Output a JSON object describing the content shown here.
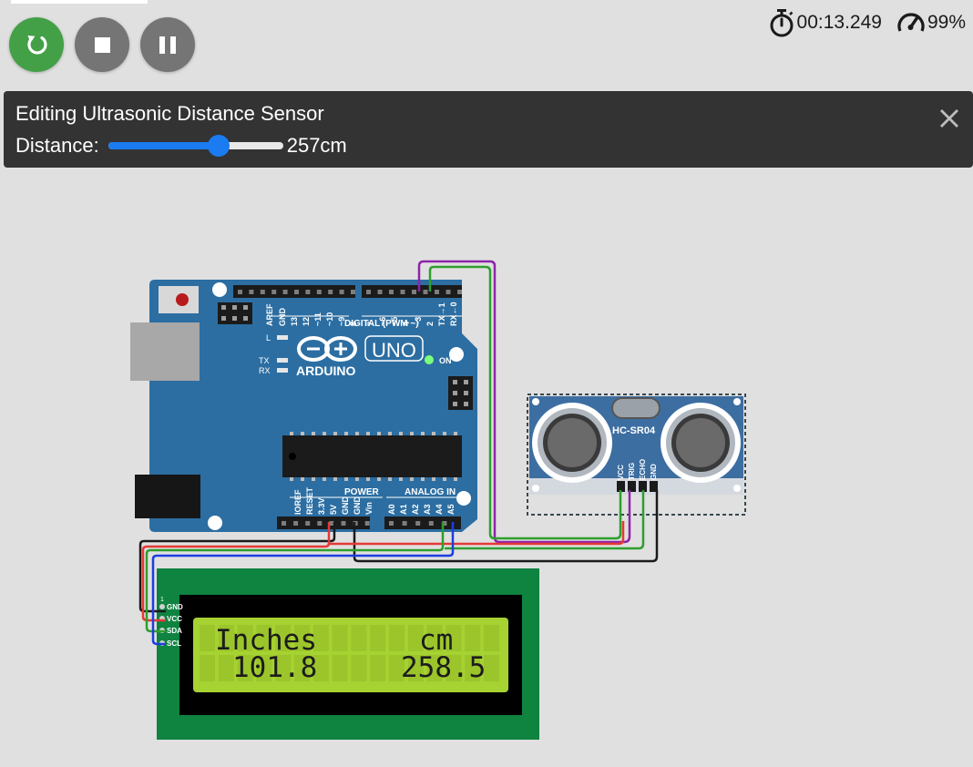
{
  "toolbar": {
    "restart_icon": "restart-icon",
    "stop_icon": "stop-icon",
    "pause_icon": "pause-icon"
  },
  "status": {
    "timer": "00:13.249",
    "speed": "99%"
  },
  "editor": {
    "title": "Editing Ultrasonic Distance Sensor",
    "distance_label": "Distance:",
    "distance_value": "257cm",
    "slider_fraction": 0.63
  },
  "board": {
    "brand": "ARDUINO",
    "model": "UNO",
    "digital_header": "DIGITAL (PWM ~)",
    "power_header": "POWER",
    "analog_header": "ANALOG IN",
    "led_l": "L",
    "led_tx": "TX",
    "led_rx": "RX",
    "on_label": "ON",
    "digital_pins": [
      "AREF",
      "GND",
      "13",
      "12",
      "~11",
      "~10",
      "~9",
      "8",
      "7",
      "~6",
      "~5",
      "4",
      "~3",
      "2",
      "TX→1",
      "RX←0"
    ],
    "power_pins": [
      "IOREF",
      "RESET",
      "3.3V",
      "5V",
      "GND",
      "GND",
      "Vin"
    ],
    "analog_pins": [
      "A0",
      "A1",
      "A2",
      "A3",
      "A4",
      "A5"
    ]
  },
  "sensor": {
    "model": "HC-SR04",
    "pins": [
      "VCC",
      "TRIG",
      "ECHO",
      "GND"
    ]
  },
  "lcd": {
    "pin_number": "1",
    "pins": [
      "GND",
      "VCC",
      "SDA",
      "SCL"
    ],
    "line1_left": "Inches",
    "line1_right": "cm",
    "line2_left": "101.8",
    "line2_right": "258.5"
  }
}
